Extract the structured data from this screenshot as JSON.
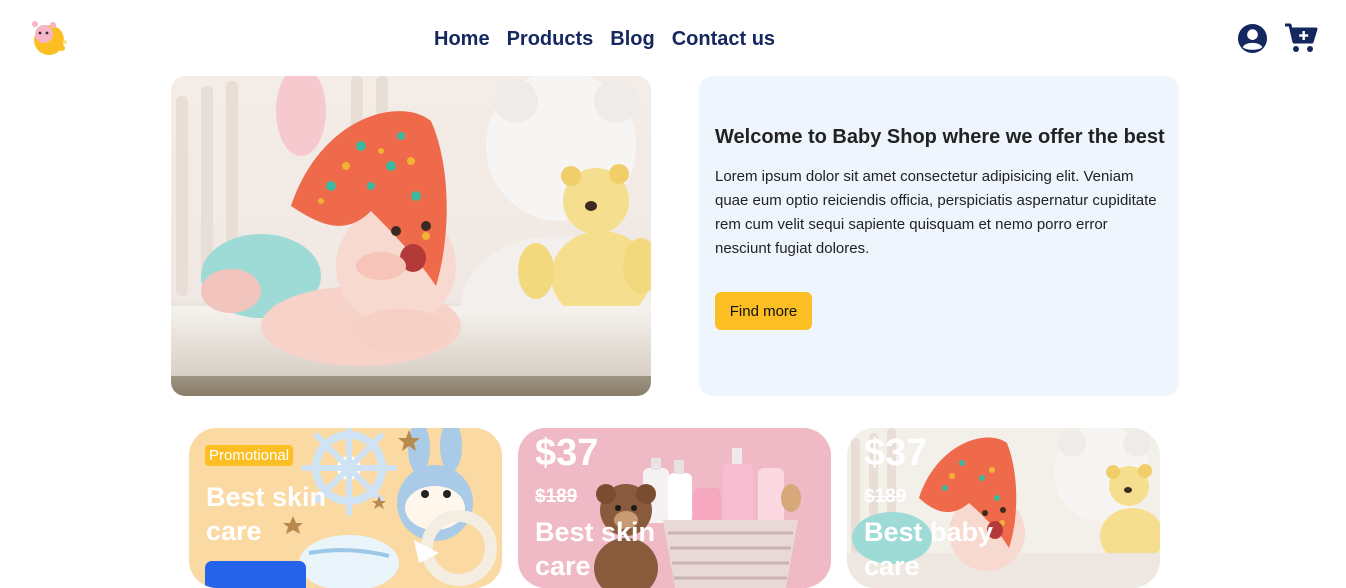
{
  "header": {
    "logo": "baby-shop-logo",
    "nav": [
      {
        "label": "Home"
      },
      {
        "label": "Products"
      },
      {
        "label": "Blog"
      },
      {
        "label": "Contact us"
      }
    ],
    "icons": [
      "user-icon",
      "cart-plus-icon"
    ],
    "nav_color": "#14275e"
  },
  "hero": {
    "title": "Welcome to Baby Shop where we offer the best",
    "text": "Lorem ipsum dolor sit amet consectetur adipisicing elit. Veniam quae eum optio reiciendis officia, perspiciatis aspernatur cupiditate rem cum velit sequi sapiente quisquam et nemo porro error nesciunt fugiat dolores.",
    "button_label": "Find more",
    "card_bg": "#eef5fd",
    "button_color": "#fbbf24"
  },
  "cards": [
    {
      "badge": "Promotional",
      "title": "Best skin care"
    },
    {
      "price": "$37",
      "old_price": "$189",
      "title": "Best skin care"
    },
    {
      "price": "$37",
      "old_price": "$189",
      "title": "Best baby care"
    }
  ]
}
